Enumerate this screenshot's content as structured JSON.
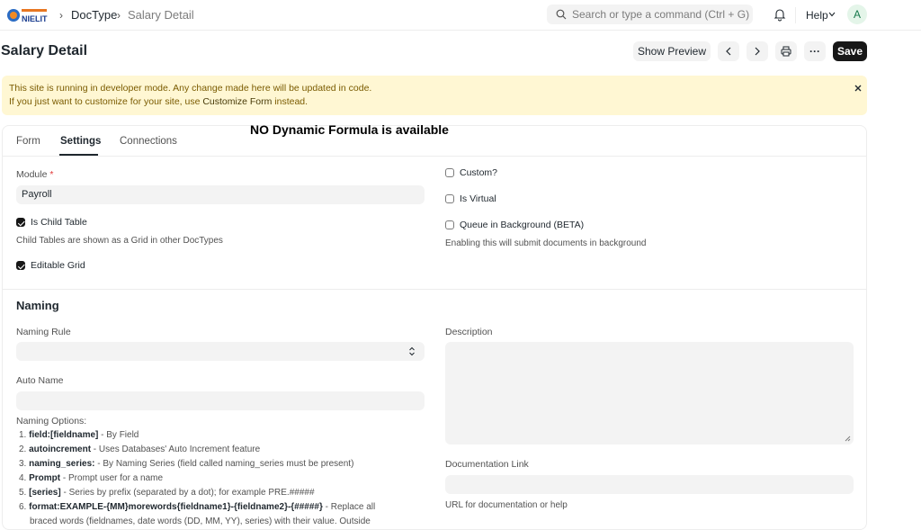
{
  "navbar": {
    "logo_text": "NIELIT",
    "breadcrumbs": [
      "DocType",
      "Salary Detail"
    ],
    "search_placeholder": "Search or type a command (Ctrl + G)",
    "help_label": "Help",
    "avatar_initial": "A"
  },
  "page": {
    "title": "Salary Detail",
    "show_preview_label": "Show Preview",
    "more_label": "···",
    "save_label": "Save"
  },
  "alert": {
    "line1": "This site is running in developer mode. Any change made here will be updated in code.",
    "line2_prefix": "If you just want to customize for your site, use ",
    "line2_link": "Customize Form",
    "line2_suffix": " instead."
  },
  "overlay_note": "NO Dynamic Formula is available",
  "tabs": [
    {
      "label": "Form",
      "active": false
    },
    {
      "label": "Settings",
      "active": true
    },
    {
      "label": "Connections",
      "active": false
    }
  ],
  "settings": {
    "module_label": "Module",
    "module_required_mark": "*",
    "module_value": "Payroll",
    "is_child_table_label": "Is Child Table",
    "is_child_table_checked": true,
    "child_table_help": "Child Tables are shown as a Grid in other DocTypes",
    "editable_grid_label": "Editable Grid",
    "editable_grid_checked": true,
    "custom_label": "Custom?",
    "custom_checked": false,
    "is_virtual_label": "Is Virtual",
    "is_virtual_checked": false,
    "queue_label": "Queue in Background (BETA)",
    "queue_checked": false,
    "queue_help": "Enabling this will submit documents in background"
  },
  "naming": {
    "section_title": "Naming",
    "naming_rule_label": "Naming Rule",
    "naming_rule_value": "",
    "auto_name_label": "Auto Name",
    "auto_name_value": "",
    "naming_options_label": "Naming Options:",
    "options": [
      {
        "num": "1.",
        "key": "field:[fieldname]",
        "desc": " - By Field"
      },
      {
        "num": "2.",
        "key": "autoincrement",
        "desc": " - Uses Databases' Auto Increment feature"
      },
      {
        "num": "3.",
        "key": "naming_series:",
        "desc": " - By Naming Series (field called naming_series must be present)"
      },
      {
        "num": "4.",
        "key": "Prompt",
        "desc": " - Prompt user for a name"
      },
      {
        "num": "5.",
        "key": "[series]",
        "desc": " - Series by prefix (separated by a dot); for example PRE.#####"
      },
      {
        "num": "6.",
        "key": "format:EXAMPLE-{MM}morewords{fieldname1}-{fieldname2}-{#####}",
        "desc": " - Replace all"
      }
    ],
    "option6_continued": "braced words (fieldnames, date words (DD, MM, YY), series) with their value. Outside",
    "description_label": "Description",
    "documentation_link_label": "Documentation Link",
    "documentation_link_help": "URL for documentation or help"
  }
}
